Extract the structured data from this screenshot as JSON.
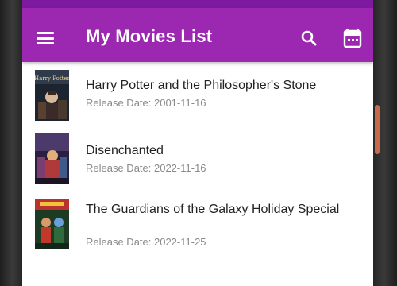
{
  "app_bar": {
    "title": "My Movies List",
    "color": "#9c27b0",
    "icons": [
      "menu-icon",
      "search-icon",
      "calendar-icon"
    ]
  },
  "movies": [
    {
      "title": "Harry Potter and the Philosopher's Stone",
      "release_label": "Release Date: 2001-11-16",
      "poster_logo": "Harry Potter"
    },
    {
      "title": "Disenchanted",
      "release_label": "Release Date: 2022-11-16"
    },
    {
      "title": "The Guardians of the Galaxy Holiday Special",
      "release_label": "Release Date: 2022-11-25"
    }
  ]
}
